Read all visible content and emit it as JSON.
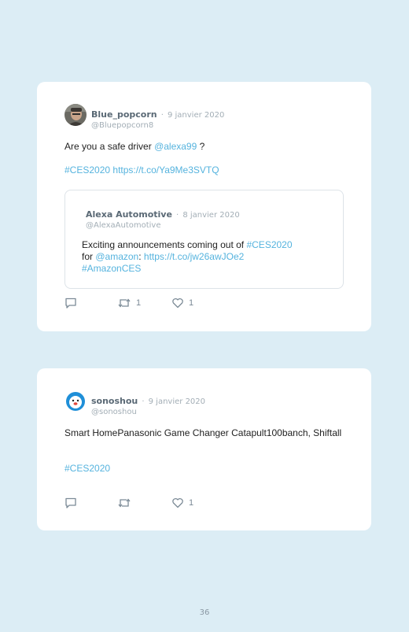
{
  "tweets": [
    {
      "author": "Blue_popcorn",
      "separator": "·",
      "date": "9 janvier 2020",
      "handle": "@Bluepopcorn8",
      "text_before": "Are you a safe driver ",
      "mention": "@alexa99",
      "text_after": " ?",
      "hashtag": "#CES2020",
      "url": "https://t.co/Ya9Me3SVTQ",
      "quoted": {
        "author": "Alexa Automotive",
        "separator": "·",
        "date": "8 janvier 2020",
        "handle": "@AlexaAutomotive",
        "text_before": "Exciting announcements coming out of ",
        "hashtag1": "#CES2020",
        "for_word": "for ",
        "mention": "@amazon",
        "colon": ": ",
        "url": "https://t.co/jw26awJOe2",
        "hashtag2": "#AmazonCES"
      },
      "actions": {
        "reply_icon": "reply-icon",
        "retweet_icon": "retweet-icon",
        "retweet_count": "1",
        "like_icon": "heart-icon",
        "like_count": "1"
      }
    },
    {
      "author": "sonoshou",
      "separator": "·",
      "date": "9 janvier 2020",
      "handle": "@sonoshou",
      "text": "Smart HomePanasonic Game Changer Catapult100banch, Shiftall",
      "hashtag": "#CES2020",
      "actions": {
        "reply_icon": "reply-icon",
        "retweet_icon": "retweet-icon",
        "like_icon": "heart-icon",
        "like_count": "1"
      }
    }
  ],
  "page_number": "36",
  "colors": {
    "background": "#dcedf5",
    "link": "#55b3de",
    "card": "#ffffff"
  }
}
